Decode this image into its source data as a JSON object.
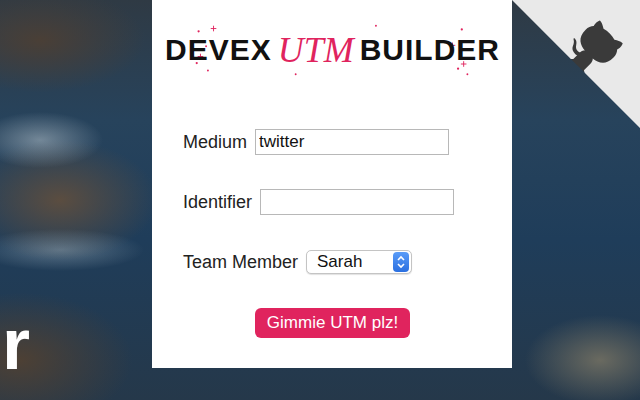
{
  "logo": {
    "left": "DEVEX",
    "middle": "UTM",
    "right": "BUILDER"
  },
  "fields": [
    {
      "label": "Medium",
      "kind": "text",
      "value": "twitter"
    },
    {
      "label": "Identifier",
      "kind": "text",
      "value": ""
    },
    {
      "label": "Team Member",
      "kind": "select",
      "value": "Sarah"
    }
  ],
  "button": "Gimmie UTM plz!",
  "background_text": "r"
}
